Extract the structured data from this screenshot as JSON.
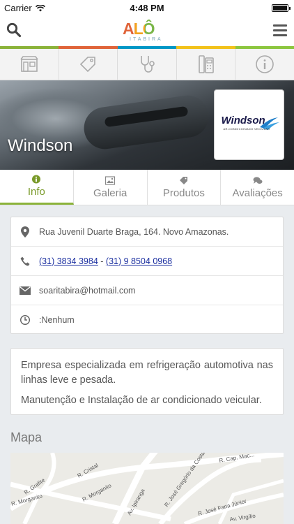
{
  "status_bar": {
    "carrier": "Carrier",
    "time": "4:48 PM"
  },
  "header": {
    "logo": {
      "brand": "ALÔ",
      "sub": "ITABIRA"
    },
    "colorbar": [
      "#8bb33a",
      "#e0643a",
      "#0097c6",
      "#f2c21a",
      "#8cc63f"
    ]
  },
  "categories": [
    {
      "icon": "store-icon"
    },
    {
      "icon": "price-tag-icon"
    },
    {
      "icon": "stethoscope-icon"
    },
    {
      "icon": "phone-icon"
    },
    {
      "icon": "info-icon"
    }
  ],
  "business": {
    "name": "Windson",
    "logo_text": "Windson",
    "logo_subtext": "AR-CONDICIONADO VEICULAR"
  },
  "tabs": [
    {
      "label": "Info",
      "icon": "info-icon",
      "active": true
    },
    {
      "label": "Galeria",
      "icon": "image-icon",
      "active": false
    },
    {
      "label": "Produtos",
      "icon": "tag-icon",
      "active": false
    },
    {
      "label": "Avaliações",
      "icon": "comments-icon",
      "active": false
    }
  ],
  "info": {
    "address": "Rua Juvenil Duarte Braga, 164. Novo Amazonas.",
    "phone1": "(31) 3834 3984",
    "phone_sep": " - ",
    "phone2": "(31) 9 8504 0968",
    "email": "soaritabira@hotmail.com",
    "hours": ":Nenhum"
  },
  "description": [
    "Empresa especializada em refrigeração automotiva nas linhas leve e pesada.",
    "Manutenção e Instalação de ar condicionado veicular."
  ],
  "map": {
    "label": "Mapa",
    "streets": [
      "R. Grafite",
      "R. Cristal",
      "R. Morganito",
      "R. Morganito",
      "Av. Ipiranga",
      "R. José Gregório da Costa",
      "R. José Faria Júnior",
      "R. Cap. Mac...",
      "Av. Virgílio"
    ]
  },
  "colors": {
    "accent": "#8bb33a",
    "link": "#1b2fa0"
  }
}
